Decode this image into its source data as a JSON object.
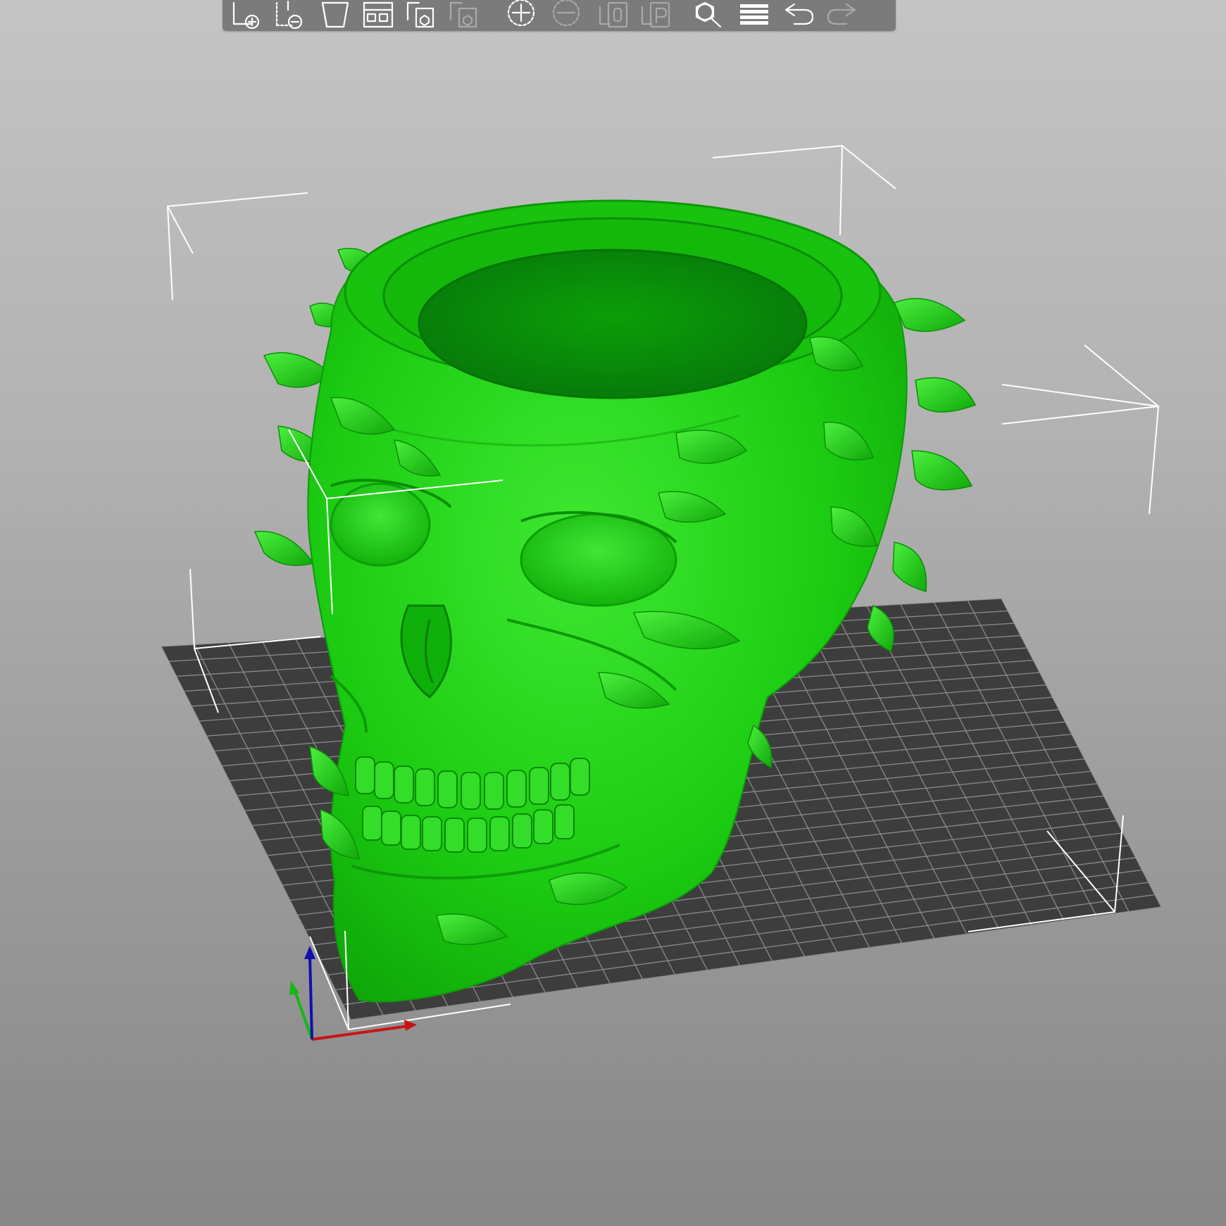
{
  "app": {
    "view": "3D",
    "background_top": "#c4c4c4",
    "background_bottom": "#878787"
  },
  "toolbar": {
    "tools": [
      {
        "id": "add",
        "icon": "add-object-icon",
        "enabled": true
      },
      {
        "id": "delete",
        "icon": "delete-object-icon",
        "enabled": true
      },
      {
        "id": "delete-all",
        "icon": "delete-all-icon",
        "enabled": true
      },
      {
        "id": "arrange",
        "icon": "arrange-icon",
        "enabled": true
      },
      {
        "id": "copy",
        "icon": "copy-icon",
        "enabled": true
      },
      {
        "id": "paste",
        "icon": "paste-icon",
        "enabled": false
      },
      {
        "id": "add-instance",
        "icon": "add-instance-icon",
        "enabled": true
      },
      {
        "id": "remove-instance",
        "icon": "remove-instance-icon",
        "enabled": false
      },
      {
        "id": "split-objects",
        "icon": "split-to-objects-icon",
        "enabled": false
      },
      {
        "id": "split-parts",
        "icon": "split-to-parts-icon",
        "enabled": false
      },
      {
        "id": "search",
        "icon": "search-icon",
        "enabled": true
      },
      {
        "id": "layers",
        "icon": "layers-editing-icon",
        "enabled": true
      },
      {
        "id": "undo",
        "icon": "undo-icon",
        "enabled": true
      },
      {
        "id": "redo",
        "icon": "redo-icon",
        "enabled": false
      }
    ]
  },
  "scene": {
    "model": {
      "name_icon": "skull-planter-model",
      "color": "#15c80a",
      "selected": true
    },
    "bed": {
      "color": "#3d3d3d",
      "grid_color": "#8a8a8a"
    },
    "axes": {
      "x_color": "#c81414",
      "y_color": "#14b814",
      "z_color": "#1010b0"
    }
  }
}
